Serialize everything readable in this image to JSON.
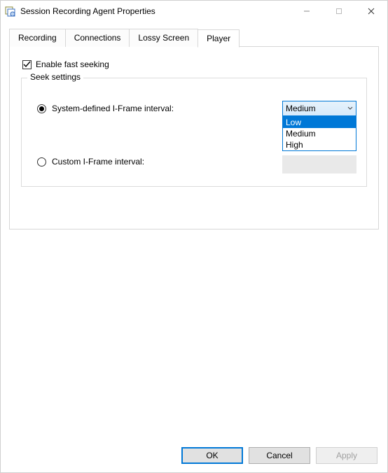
{
  "titlebar": {
    "title": "Session Recording Agent Properties"
  },
  "tabs": [
    {
      "label": "Recording",
      "active": false
    },
    {
      "label": "Connections",
      "active": false
    },
    {
      "label": "Lossy Screen",
      "active": false
    },
    {
      "label": "Player",
      "active": true
    }
  ],
  "panel": {
    "enable_fast_seeking_label": "Enable fast seeking",
    "enable_fast_seeking_checked": true,
    "fieldset_legend": "Seek settings",
    "radio_system_label": "System-defined I-Frame interval:",
    "radio_custom_label": "Custom I-Frame interval:",
    "radio_selected": "system",
    "dropdown": {
      "selected": "Medium",
      "options": [
        "Low",
        "Medium",
        "High"
      ],
      "highlighted": "Low"
    }
  },
  "footer": {
    "ok": "OK",
    "cancel": "Cancel",
    "apply": "Apply"
  }
}
